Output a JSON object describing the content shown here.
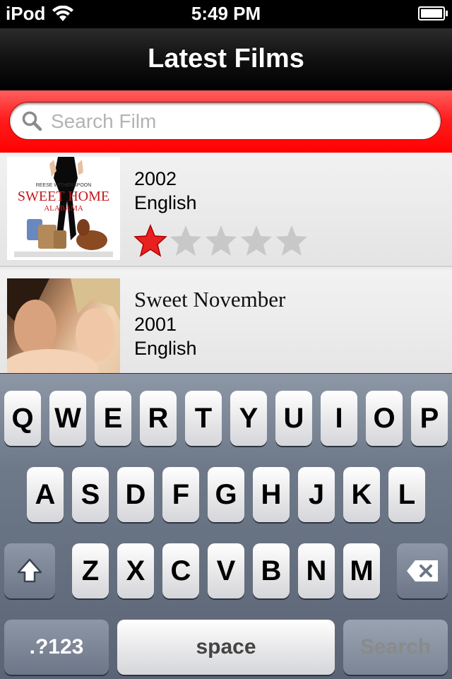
{
  "status_bar": {
    "carrier": "iPod",
    "time": "5:49 PM"
  },
  "nav": {
    "title": "Latest Films"
  },
  "search": {
    "placeholder": "Search Film",
    "value": ""
  },
  "films": [
    {
      "poster": "Sweet Home Alabama poster",
      "poster_tagline": "REESE WITHERSPOON",
      "poster_title": "SWEET HOME",
      "poster_title2": "ALABAMA",
      "year": "2002",
      "language": "English",
      "rating": 1,
      "max_rating": 5
    },
    {
      "poster": "Sweet November poster",
      "title": "Sweet November",
      "year": "2001",
      "language": "English"
    }
  ],
  "keyboard": {
    "row1": [
      "Q",
      "W",
      "E",
      "R",
      "T",
      "Y",
      "U",
      "I",
      "O",
      "P"
    ],
    "row2": [
      "A",
      "S",
      "D",
      "F",
      "G",
      "H",
      "J",
      "K",
      "L"
    ],
    "row3": [
      "Z",
      "X",
      "C",
      "V",
      "B",
      "N",
      "M"
    ],
    "numbers_label": ".?123",
    "space_label": "space",
    "search_label": "Search"
  },
  "colors": {
    "search_bar": "#ff2020",
    "star_filled": "#e8201e",
    "star_empty": "#c8c8c8"
  }
}
